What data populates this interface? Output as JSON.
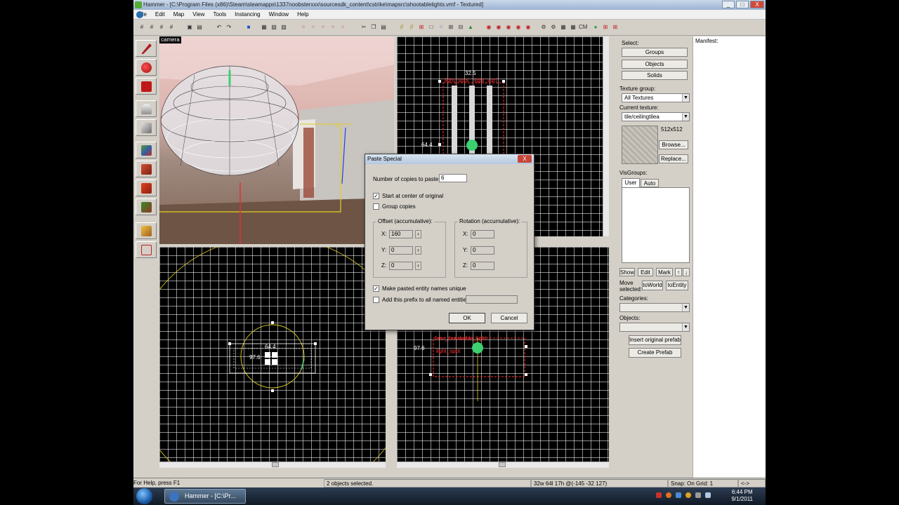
{
  "window": {
    "title": "Hammer - [C:\\Program Files (x86)\\Steam\\steamapps\\1337noobsterxxx\\sourcesdk_content\\cstrike\\mapsrc\\shootablelights.vmf - Textured]",
    "min_label": "_",
    "max_label": "□",
    "close_label": "X"
  },
  "menu": [
    "File",
    "Edit",
    "Map",
    "View",
    "Tools",
    "Instancing",
    "Window",
    "Help"
  ],
  "camera_view": {
    "label": "camera"
  },
  "top_view": {
    "dim_top": "32.5",
    "dim_left": "64.4",
    "entity_name": "light_spot",
    "entity_target": "light_surf"
  },
  "front_view": {
    "dim_top": "64.4",
    "dim_left": "97.6"
  },
  "side_view": {
    "dim_left": "97.6",
    "entity_name": "func_breakable_light",
    "entity_target": "light_spot"
  },
  "right_panel": {
    "select_label": "Select:",
    "groups_btn": "Groups",
    "objects_btn": "Objects",
    "solids_btn": "Solids",
    "texture_group_label": "Texture group:",
    "texture_group_value": "All Textures",
    "current_texture_label": "Current texture:",
    "current_texture_value": "tile/ceilingtilea",
    "texture_size": "512x512",
    "browse_btn": "Browse...",
    "replace_btn": "Replace...",
    "visgroups_label": "VisGroups:",
    "tab_user": "User",
    "tab_auto": "Auto",
    "show_btn": "Show",
    "edit_btn": "Edit",
    "mark_btn": "Mark",
    "up_btn": "↑",
    "down_btn": "↓",
    "move_selected_label": "Move selected:",
    "to_world_btn": "toWorld",
    "to_entity_btn": "toEntity",
    "categories_label": "Categories:",
    "objects_label": "Objects:",
    "insert_prefab_btn": "Insert original prefab",
    "create_prefab_btn": "Create Prefab"
  },
  "manifest": {
    "label": "Manifest:"
  },
  "status": {
    "help": "For Help, press F1",
    "selection": "2 objects selected.",
    "coords": "32w 64l 17h @(-145 -32 127)",
    "snap": "Snap: On Grid: 1",
    "arrows": "<->"
  },
  "dialog": {
    "title": "Paste Special",
    "close_label": "X",
    "copies_label": "Number of copies to paste:",
    "copies_value": "6",
    "start_center_label": "Start at center of original",
    "start_center_checked": true,
    "group_copies_label": "Group copies",
    "group_copies_checked": false,
    "offset_group": "Offset (accumulative):",
    "offset": {
      "x_label": "X:",
      "x": "160",
      "y_label": "Y:",
      "y": "0",
      "z_label": "Z:",
      "z": "0"
    },
    "rotation_group": "Rotation (accumulative):",
    "rotation": {
      "x_label": "X:",
      "x": "0",
      "y_label": "Y:",
      "y": "0",
      "z_label": "Z:",
      "z": "0"
    },
    "unique_names_label": "Make pasted entity names unique",
    "unique_names_checked": true,
    "prefix_label": "Add this prefix to all named entities:",
    "prefix_value": "",
    "ok_label": "OK",
    "cancel_label": "Cancel"
  },
  "taskbar": {
    "item_label": "Hammer - [C:\\Pr...",
    "time": "6:44 PM",
    "date": "9/1/2011"
  },
  "colors": {
    "wire": "#ffffff",
    "selection": "#ff3030",
    "axis_yellow": "#e0d020",
    "entity_green": "#3bd070"
  }
}
